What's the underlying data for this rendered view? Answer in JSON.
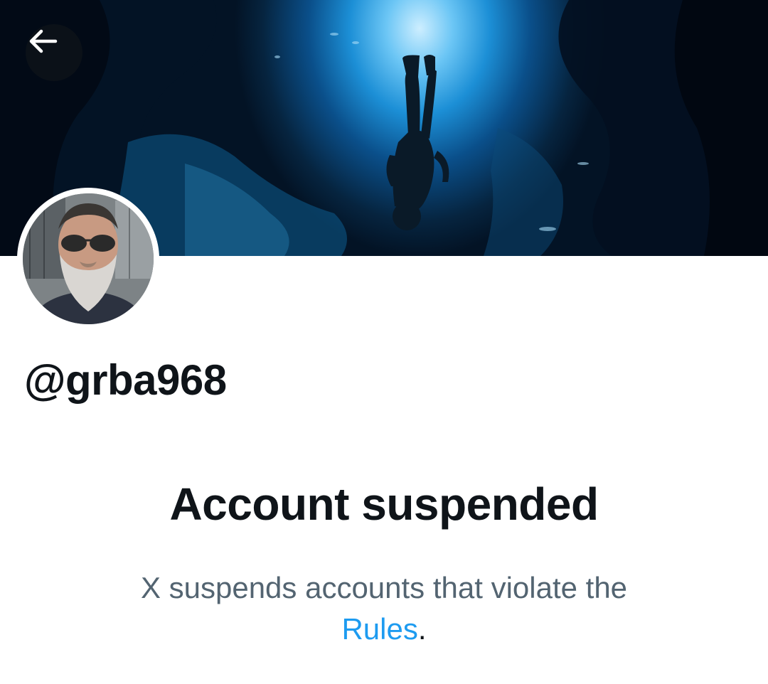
{
  "header": {
    "back_icon": "arrow-left-icon"
  },
  "profile": {
    "handle": "@grba968"
  },
  "suspension": {
    "title": "Account suspended",
    "message": "X suspends accounts that violate the",
    "rules_link_label": "Rules",
    "trailing_punctuation": "."
  },
  "colors": {
    "text_primary": "#0f1419",
    "text_secondary": "#536471",
    "link": "#1d9bf0"
  }
}
